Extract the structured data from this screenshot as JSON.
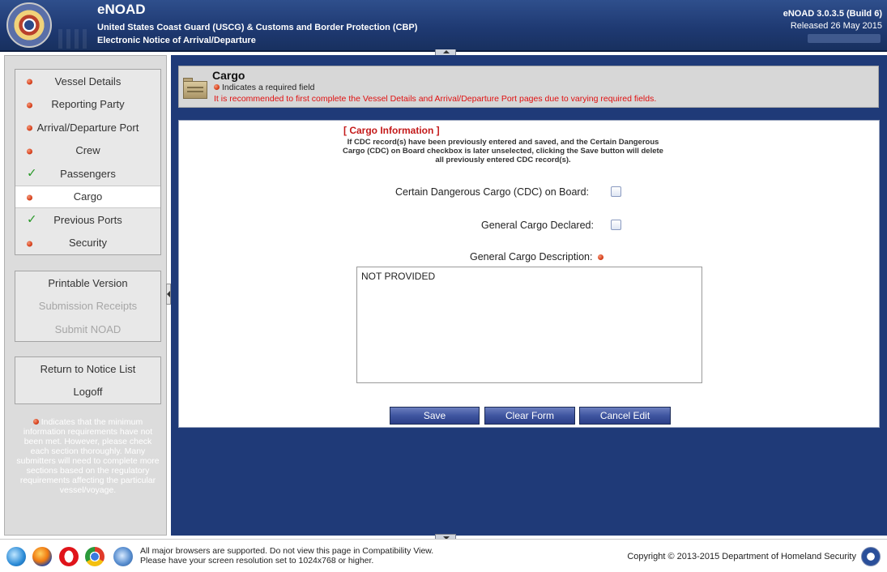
{
  "header": {
    "app_title": "eNOAD",
    "subtitle": "United States Coast Guard (USCG) & Customs and Border Protection (CBP)",
    "subtitle2": "Electronic Notice of Arrival/Departure",
    "version": "eNOAD 3.0.3.5 (Build 6)",
    "release": "Released 26 May 2015"
  },
  "sidebar": {
    "sections": [
      {
        "label": "Vessel Details",
        "status": "required"
      },
      {
        "label": "Reporting Party",
        "status": "required"
      },
      {
        "label": "Arrival/Departure Port",
        "status": "required"
      },
      {
        "label": "Crew",
        "status": "required"
      },
      {
        "label": "Passengers",
        "status": "complete"
      },
      {
        "label": "Cargo",
        "status": "required",
        "active": true
      },
      {
        "label": "Previous Ports",
        "status": "complete"
      },
      {
        "label": "Security",
        "status": "required"
      }
    ],
    "actions": {
      "printable": "Printable Version",
      "receipts": "Submission Receipts",
      "submit": "Submit NOAD"
    },
    "nav": {
      "return": "Return to Notice List",
      "logoff": "Logoff"
    },
    "legend": "Indicates that the minimum information requirements have not been met. However, please check each section thoroughly. Many submitters will need to complete more sections based on the regulatory requirements affecting the particular vessel/voyage."
  },
  "page": {
    "title": "Cargo",
    "required_note": "Indicates a required field",
    "warning": "It is recommended to first complete the Vessel Details and Arrival/Departure Port pages due to varying required fields."
  },
  "form": {
    "section_title": "[ Cargo Information ]",
    "cdc_note": "If CDC record(s) have been previously entered and saved, and the Certain Dangerous Cargo (CDC) on Board checkbox is later unselected, clicking the Save button will delete all previously entered CDC record(s).",
    "cdc_label": "Certain Dangerous Cargo (CDC) on Board:",
    "general_declared_label": "General Cargo Declared:",
    "description_label": "General Cargo Description:",
    "description_value": "NOT PROVIDED",
    "buttons": {
      "save": "Save",
      "clear": "Clear Form",
      "cancel": "Cancel Edit"
    }
  },
  "footer": {
    "browsers_line1": "All major browsers are supported. Do not view this page in Compatibility View.",
    "browsers_line2": "Please have your screen resolution set to 1024x768 or higher.",
    "copyright": "Copyright © 2013-2015 Department of Homeland Security",
    "browser_icons": [
      "safari-icon",
      "firefox-icon",
      "opera-icon",
      "chrome-icon",
      "ie-icon"
    ]
  },
  "colors": {
    "header_blue": "#1f3a73",
    "main_blue": "#1f3a78",
    "required_red": "#d8401c",
    "complete_green": "#2c9a2c",
    "warning_red": "#e01010",
    "button_blue": "#3f55a0"
  }
}
